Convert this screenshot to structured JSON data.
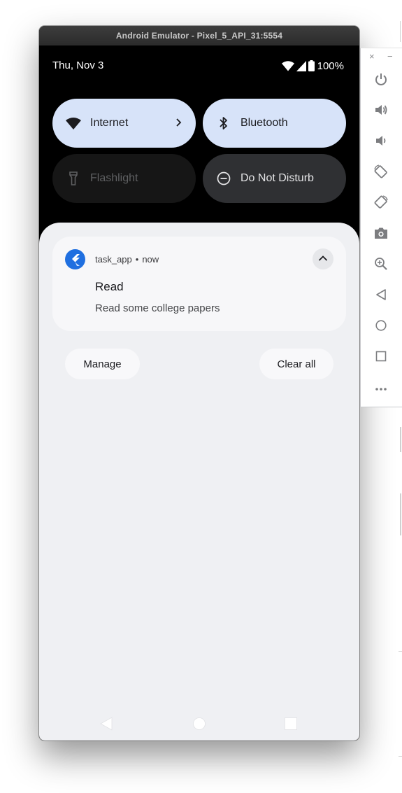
{
  "window": {
    "title": "Android Emulator - Pixel_5_API_31:5554"
  },
  "status_bar": {
    "date": "Thu, Nov 3",
    "battery": "100%",
    "icons": [
      "wifi-icon",
      "signal-icon",
      "battery-icon"
    ]
  },
  "quick_settings": [
    {
      "label": "Internet",
      "icon": "wifi-icon",
      "state": "on",
      "has_chevron": true
    },
    {
      "label": "Bluetooth",
      "icon": "bluetooth-icon",
      "state": "on"
    },
    {
      "label": "Flashlight",
      "icon": "flashlight-icon",
      "state": "unavailable"
    },
    {
      "label": "Do Not Disturb",
      "icon": "do-not-disturb-icon",
      "state": "off"
    }
  ],
  "notification": {
    "app_name": "task_app",
    "separator": "•",
    "time": "now",
    "title": "Read",
    "text": "Read some college papers",
    "icon": "flutter-app-icon",
    "expanded": true
  },
  "shade_actions": {
    "manage": "Manage",
    "clear_all": "Clear all"
  },
  "nav_bar": [
    "back-icon",
    "home-icon",
    "recents-icon"
  ],
  "emulator_toolbar": {
    "window_controls": {
      "close": "×",
      "minimize": "−"
    },
    "buttons": [
      "power-icon",
      "volume-up-icon",
      "volume-down-icon",
      "rotate-left-icon",
      "rotate-right-icon",
      "camera-icon",
      "zoom-icon",
      "back-icon",
      "home-icon",
      "overview-icon",
      "more-icon"
    ]
  },
  "colors": {
    "tile_active": "#d7e3f9",
    "tile_inactive": "#2f3033",
    "tile_unavailable": "#161616",
    "shade": "#eff0f3",
    "app_icon": "#1f6fe0",
    "title_bar": "#2b2b2b"
  }
}
